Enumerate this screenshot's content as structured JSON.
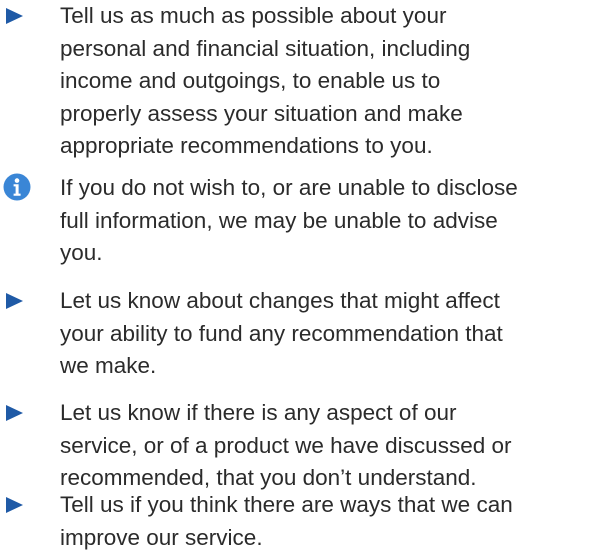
{
  "accent_color": "#1f5aa6",
  "info_color": "#3a86d6",
  "text_color": "#2b2b2b",
  "items": [
    {
      "icon": "arrow-bullet-icon",
      "lines": [
        "Tell us as much as possible about your",
        "personal and financial situation, including",
        "income and outgoings, to enable us to",
        "properly assess your situation and make",
        "appropriate recommendations to you."
      ]
    },
    {
      "icon": "info-icon",
      "lines": [
        "If you do not wish to, or are unable to disclose",
        "full information, we may be unable to advise",
        "you."
      ]
    },
    {
      "icon": "arrow-bullet-icon",
      "lines": [
        "Let us know about changes that might affect",
        "your ability to fund any recommendation that",
        "we make."
      ]
    },
    {
      "icon": "arrow-bullet-icon",
      "lines": [
        "Let us know if there is any aspect of our",
        "service, or of a product we have discussed or",
        "recommended, that you don’t understand."
      ]
    },
    {
      "icon": "arrow-bullet-icon",
      "lines": [
        "Tell us if you think there are ways that we can",
        "improve our service."
      ]
    }
  ]
}
